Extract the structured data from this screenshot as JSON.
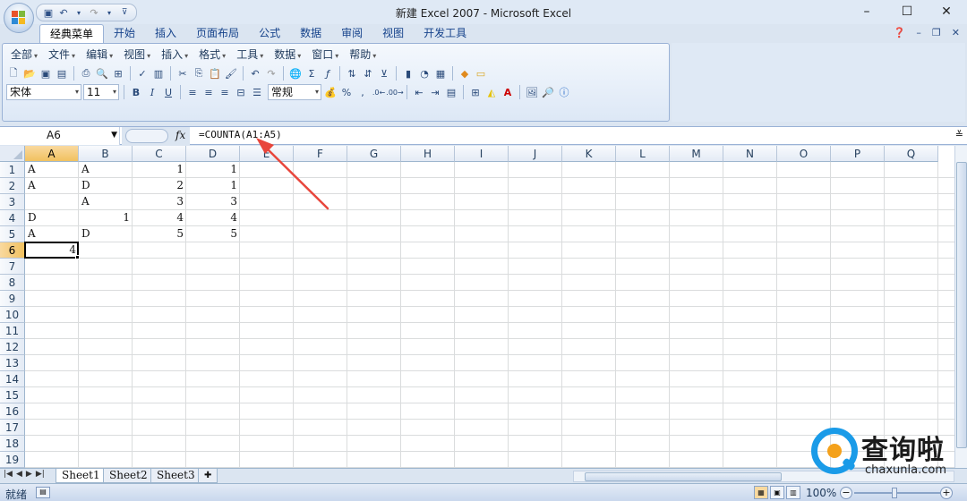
{
  "window": {
    "title": "新建 Excel 2007 - Microsoft Excel"
  },
  "tabs": [
    "经典菜单",
    "开始",
    "插入",
    "页面布局",
    "公式",
    "数据",
    "审阅",
    "视图",
    "开发工具"
  ],
  "active_tab": "经典菜单",
  "menus": [
    "全部",
    "文件",
    "编辑",
    "视图",
    "插入",
    "格式",
    "工具",
    "数据",
    "窗口",
    "帮助"
  ],
  "toolbar": {
    "font_name": "宋体",
    "font_size": "11",
    "number_format": "常规",
    "bold": "B",
    "italic": "I",
    "underline": "U",
    "percent": "%",
    "comma": ","
  },
  "formula_bar": {
    "name_box": "A6",
    "fx": "fx",
    "formula": "=COUNTA(A1:A5)"
  },
  "columns": [
    "A",
    "B",
    "C",
    "D",
    "E",
    "F",
    "G",
    "H",
    "I",
    "J",
    "K",
    "L",
    "M",
    "N",
    "O",
    "P",
    "Q"
  ],
  "rows": [
    "1",
    "2",
    "3",
    "4",
    "5",
    "6",
    "7",
    "8",
    "9",
    "10",
    "11",
    "12",
    "13",
    "14",
    "15",
    "16",
    "17",
    "18",
    "19"
  ],
  "cells": [
    {
      "ref": "A1",
      "value": "A",
      "align": "left"
    },
    {
      "ref": "B1",
      "value": "A",
      "align": "left"
    },
    {
      "ref": "C1",
      "value": "1",
      "align": "right"
    },
    {
      "ref": "D1",
      "value": "1",
      "align": "right"
    },
    {
      "ref": "A2",
      "value": "A",
      "align": "left"
    },
    {
      "ref": "B2",
      "value": "D",
      "align": "left"
    },
    {
      "ref": "C2",
      "value": "2",
      "align": "right"
    },
    {
      "ref": "D2",
      "value": "1",
      "align": "right"
    },
    {
      "ref": "B3",
      "value": "A",
      "align": "left"
    },
    {
      "ref": "C3",
      "value": "3",
      "align": "right"
    },
    {
      "ref": "D3",
      "value": "3",
      "align": "right"
    },
    {
      "ref": "A4",
      "value": "D",
      "align": "left"
    },
    {
      "ref": "B4",
      "value": "1",
      "align": "right"
    },
    {
      "ref": "C4",
      "value": "4",
      "align": "right"
    },
    {
      "ref": "D4",
      "value": "4",
      "align": "right"
    },
    {
      "ref": "A5",
      "value": "A",
      "align": "left"
    },
    {
      "ref": "B5",
      "value": "D",
      "align": "left"
    },
    {
      "ref": "C5",
      "value": "5",
      "align": "right"
    },
    {
      "ref": "D5",
      "value": "5",
      "align": "right"
    },
    {
      "ref": "A6",
      "value": "4",
      "align": "right"
    }
  ],
  "active_cell": "A6",
  "sheets": [
    "Sheet1",
    "Sheet2",
    "Sheet3"
  ],
  "active_sheet": "Sheet1",
  "status": {
    "ready": "就绪",
    "zoom": "100%"
  },
  "watermark": {
    "cn": "查询啦",
    "en": "chaxunla.com"
  },
  "colors": {
    "selected_header": "#f1c15f",
    "annotation_arrow": "#e8463c",
    "ribbon_bg": "#dfe9f5"
  }
}
